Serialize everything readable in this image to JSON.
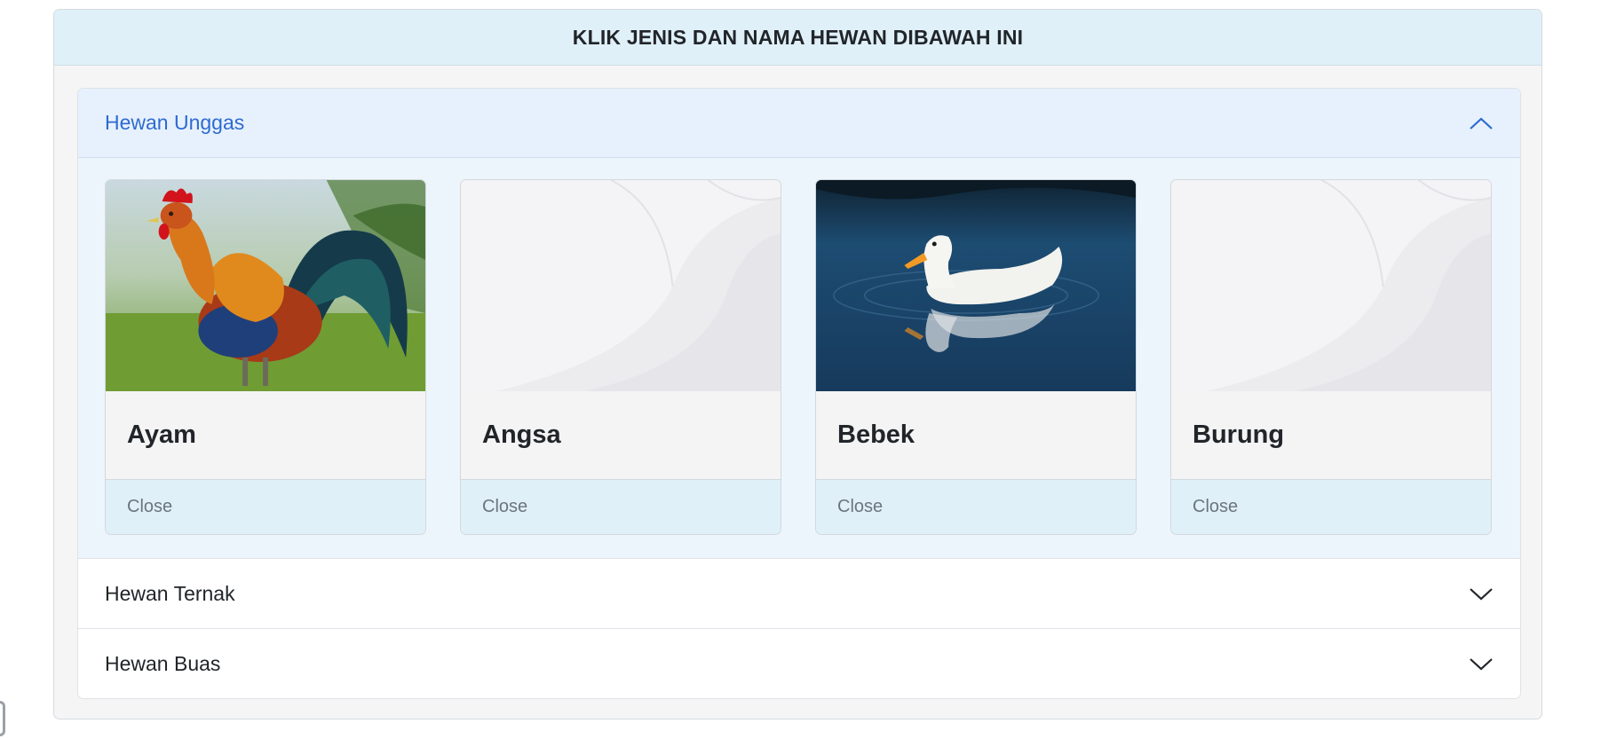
{
  "header": {
    "title": "KLIK JENIS DAN NAMA HEWAN DIBAWAH INI"
  },
  "accordion": {
    "sections": [
      {
        "label": "Hewan Unggas",
        "expanded": true,
        "cards": [
          {
            "name": "Ayam",
            "footer": "Close",
            "image": "rooster-photo"
          },
          {
            "name": "Angsa",
            "footer": "Close",
            "image": "placeholder-wave"
          },
          {
            "name": "Bebek",
            "footer": "Close",
            "image": "duck-photo"
          },
          {
            "name": "Burung",
            "footer": "Close",
            "image": "placeholder-wave"
          }
        ]
      },
      {
        "label": "Hewan Ternak",
        "expanded": false
      },
      {
        "label": "Hewan Buas",
        "expanded": false
      }
    ]
  },
  "colors": {
    "header_bg": "#dff0f8",
    "active_section_bg": "#e7f1fe",
    "active_section_text": "#2d6bd0",
    "card_footer_bg": "#dff0f8"
  },
  "icons": {
    "expanded": "chevron-up-icon",
    "collapsed": "chevron-down-icon"
  }
}
